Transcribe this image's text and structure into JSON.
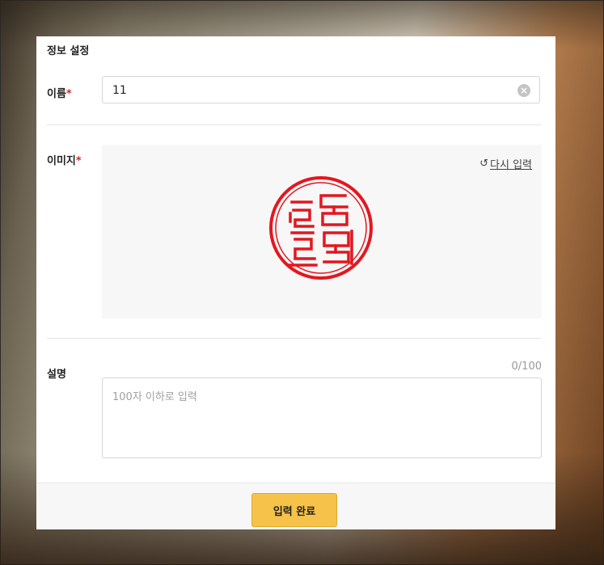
{
  "form": {
    "title": "정보 설정",
    "required_mark": "*",
    "name": {
      "label": "이름",
      "value": "11",
      "clear_icon": "clear-circle-icon"
    },
    "image": {
      "label": "이미지",
      "reset_label": "다시 입력",
      "reset_icon": "undo-icon",
      "seal_color": "#e3171f"
    },
    "description": {
      "label": "설명",
      "counter": "0/100",
      "placeholder": "100자 이하로 입력",
      "value": ""
    },
    "submit_label": "입력 완료"
  },
  "colors": {
    "accent_button": "#f7c24a",
    "required": "#d12c2c"
  }
}
